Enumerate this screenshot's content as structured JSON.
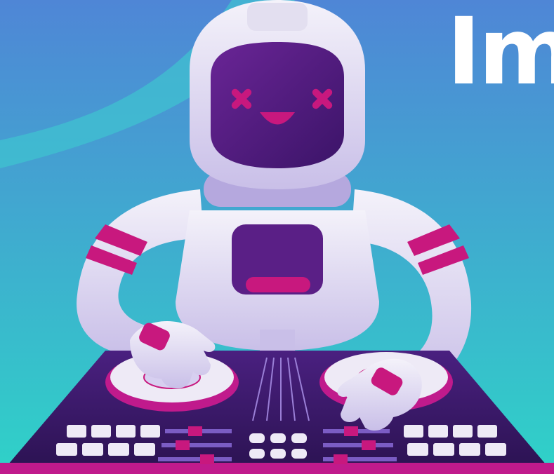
{
  "headline": "Im",
  "illustration": {
    "subject": "astronaut-dj-robot-icon",
    "colors": {
      "background_top": "#4f86d6",
      "background_bottom": "#2fd2c8",
      "swoosh": "#3fc4d0",
      "suit_light": "#eeeaf6",
      "suit_shade": "#b5a8de",
      "visor": "#5a1f86",
      "accent": "#c8187e",
      "deck": "#3a1b66",
      "deck_edge": "#c01a8c"
    }
  }
}
